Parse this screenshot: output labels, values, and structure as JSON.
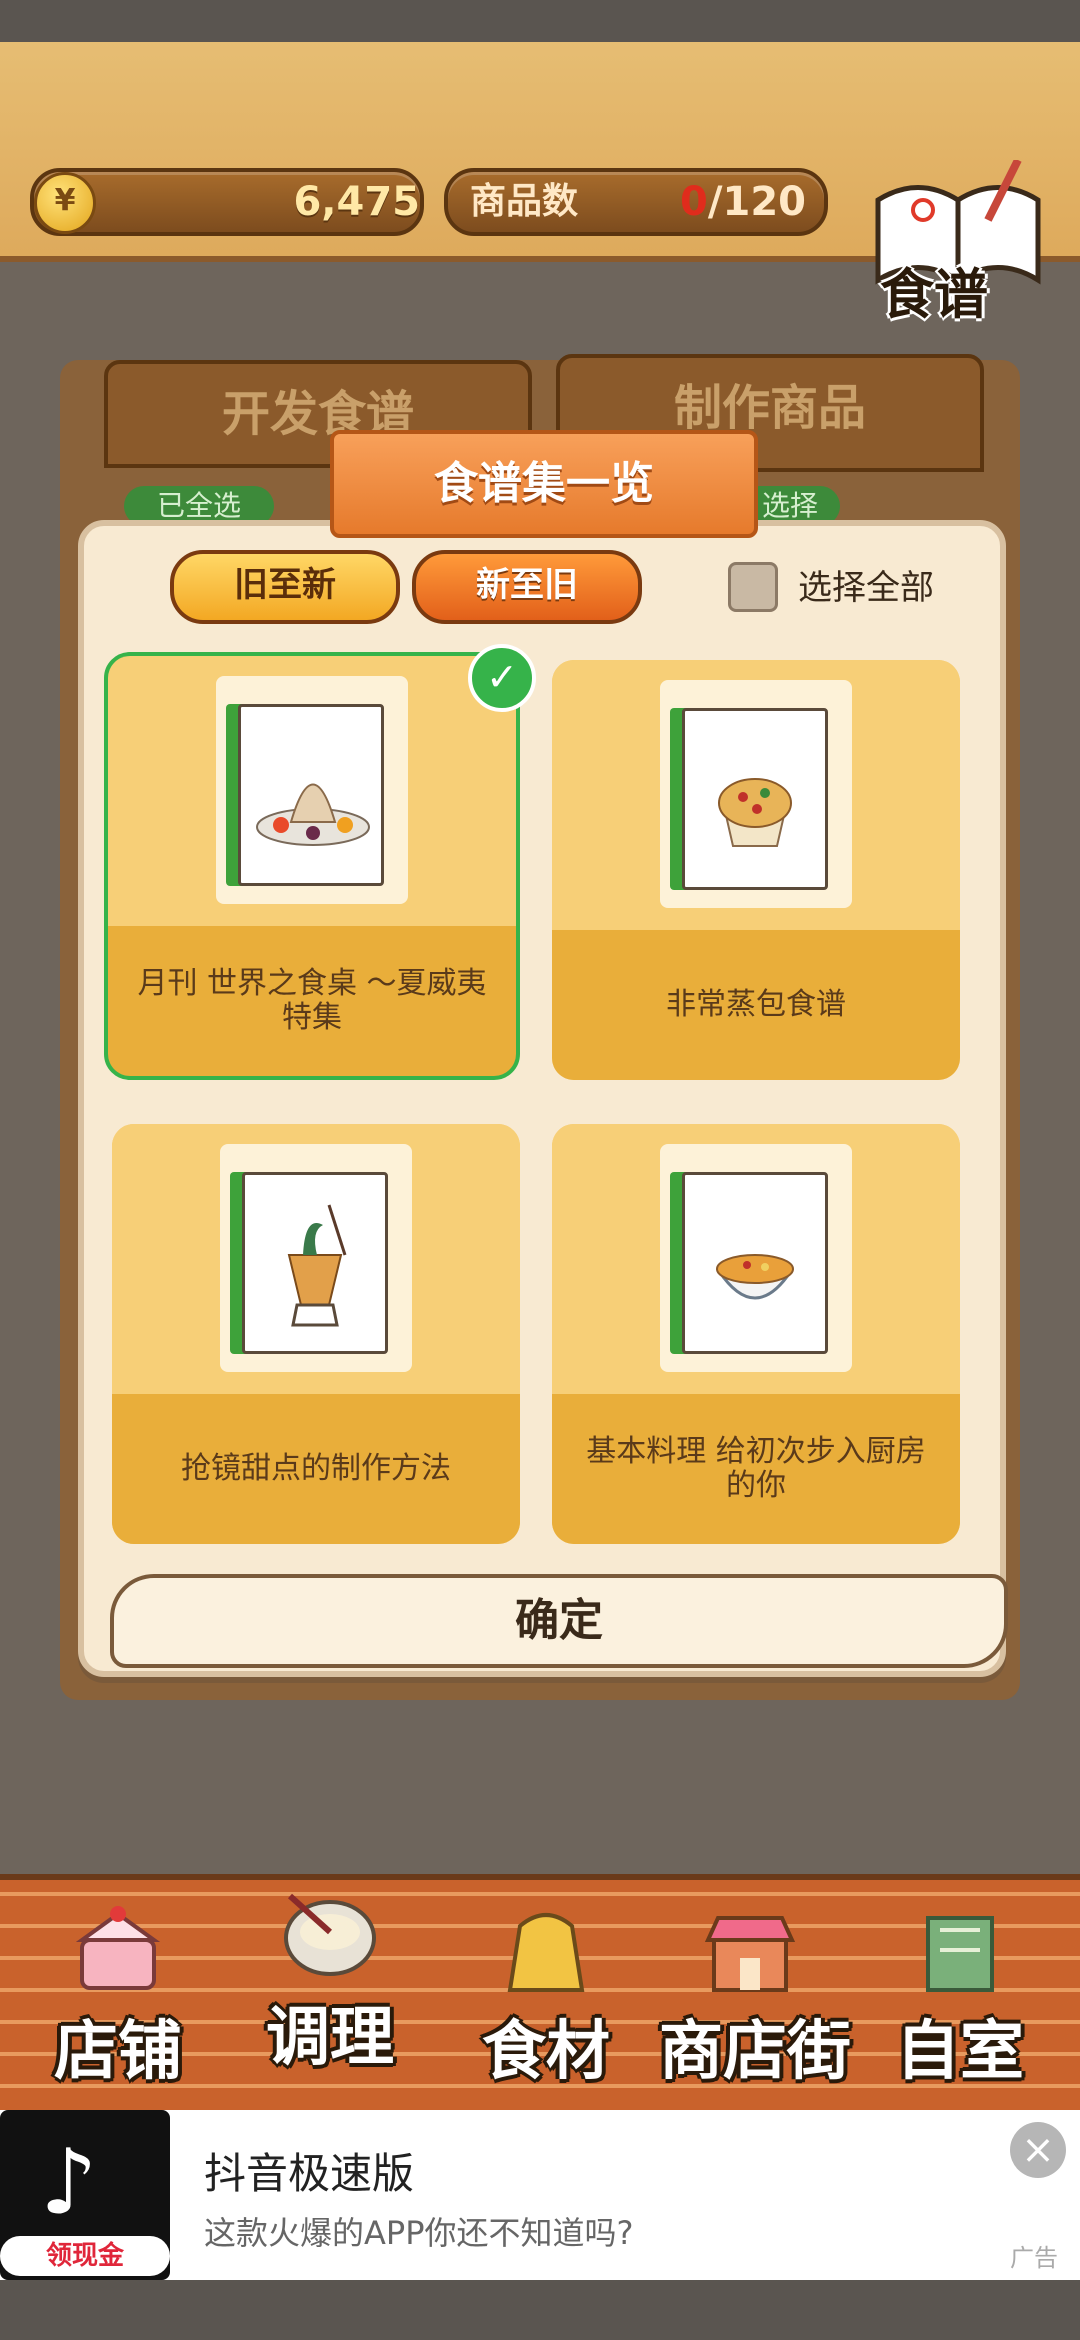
{
  "top": {
    "coins": "6,475",
    "goods_label": "商品数",
    "goods_current": "0",
    "goods_total": "/120",
    "recipe_button": "食谱"
  },
  "background_tabs": {
    "develop": "开发食谱",
    "make": "制作商品",
    "badge_left": "已全选",
    "badge_right": "选择"
  },
  "dialog": {
    "title": "食谱集一览",
    "sort_old_to_new": "旧至新",
    "sort_new_to_old": "新至旧",
    "select_all": "选择全部",
    "confirm": "确定",
    "cards": [
      {
        "label": "月刊 世界之食桌 ～夏威夷特集",
        "icon": "shaved-ice-plate",
        "selected": true
      },
      {
        "label": "非常蒸包食谱",
        "icon": "muffin",
        "selected": false
      },
      {
        "label": "抢镜甜点的制作方法",
        "icon": "parfait-cup",
        "selected": false
      },
      {
        "label": "基本料理 给初次步入厨房的你",
        "icon": "rice-bowl",
        "selected": false
      }
    ]
  },
  "nav": [
    {
      "label": "店铺",
      "icon": "cake-icon"
    },
    {
      "label": "调理",
      "icon": "mixing-bowl-icon"
    },
    {
      "label": "食材",
      "icon": "flour-sack-icon"
    },
    {
      "label": "商店街",
      "icon": "shop-icon"
    },
    {
      "label": "自室",
      "icon": "staff-only-door-icon"
    }
  ],
  "ad": {
    "title": "抖音极速版",
    "subtitle": "这款火爆的APP你还不知道吗?",
    "badge": "领现金",
    "tag": "广告",
    "close": "×"
  }
}
